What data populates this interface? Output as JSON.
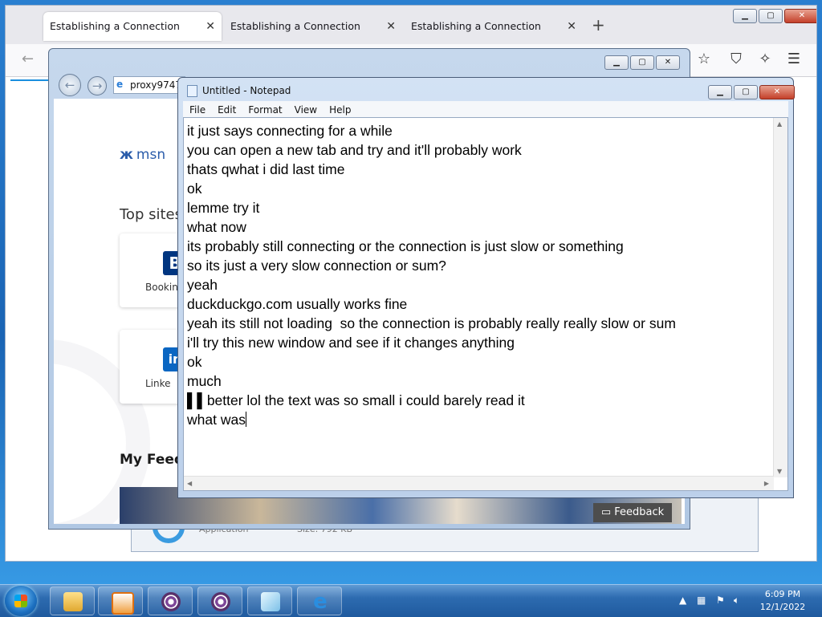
{
  "firefox": {
    "tabs": [
      {
        "label": "Establishing a Connection"
      },
      {
        "label": "Establishing a Connection"
      },
      {
        "label": "Establishing a Connection"
      }
    ],
    "close_glyph": "✕",
    "new_tab_glyph": "+",
    "back_glyph": "←",
    "icons": [
      "star-icon",
      "shield-icon",
      "extensions-icon",
      "menu-icon"
    ]
  },
  "ie": {
    "address": "proxy9747",
    "page": {
      "brand": "msn",
      "top_sites_heading": "Top sites",
      "sites": [
        {
          "label": "Bookin",
          "logo": "B",
          "color": "#003580"
        },
        {
          "label": "Linke",
          "logo": "in",
          "color": "#0a66c2"
        }
      ],
      "feed_heading": "My Feed",
      "feedback_label": "Feedback"
    }
  },
  "background_window": {
    "type_label": "Application",
    "size_label": "Size: 792 KB"
  },
  "notepad": {
    "title": "Untitled - Notepad",
    "menu": [
      "File",
      "Edit",
      "Format",
      "View",
      "Help"
    ],
    "lines": [
      "it just says connecting for a while",
      "you can open a new tab and try and it'll probably work",
      "thats qwhat i did last time",
      "ok",
      "lemme try it",
      "what now",
      "its probably still connecting or the connection is just slow or something",
      "so its just a very slow connection or sum?",
      "yeah",
      "duckduckgo.com usually works fine",
      "yeah its still not loading  so the connection is probably really really slow or sum",
      "i'll try this new window and see if it changes anything",
      "ok",
      "much",
      "better lol the text was so small i could barely read it",
      "what was"
    ]
  },
  "taskbar": {
    "time": "6:09 PM",
    "date": "12/1/2022",
    "buttons": [
      "explorer",
      "media-player",
      "tor-browser",
      "tor-browser",
      "notepad",
      "internet-explorer"
    ]
  }
}
